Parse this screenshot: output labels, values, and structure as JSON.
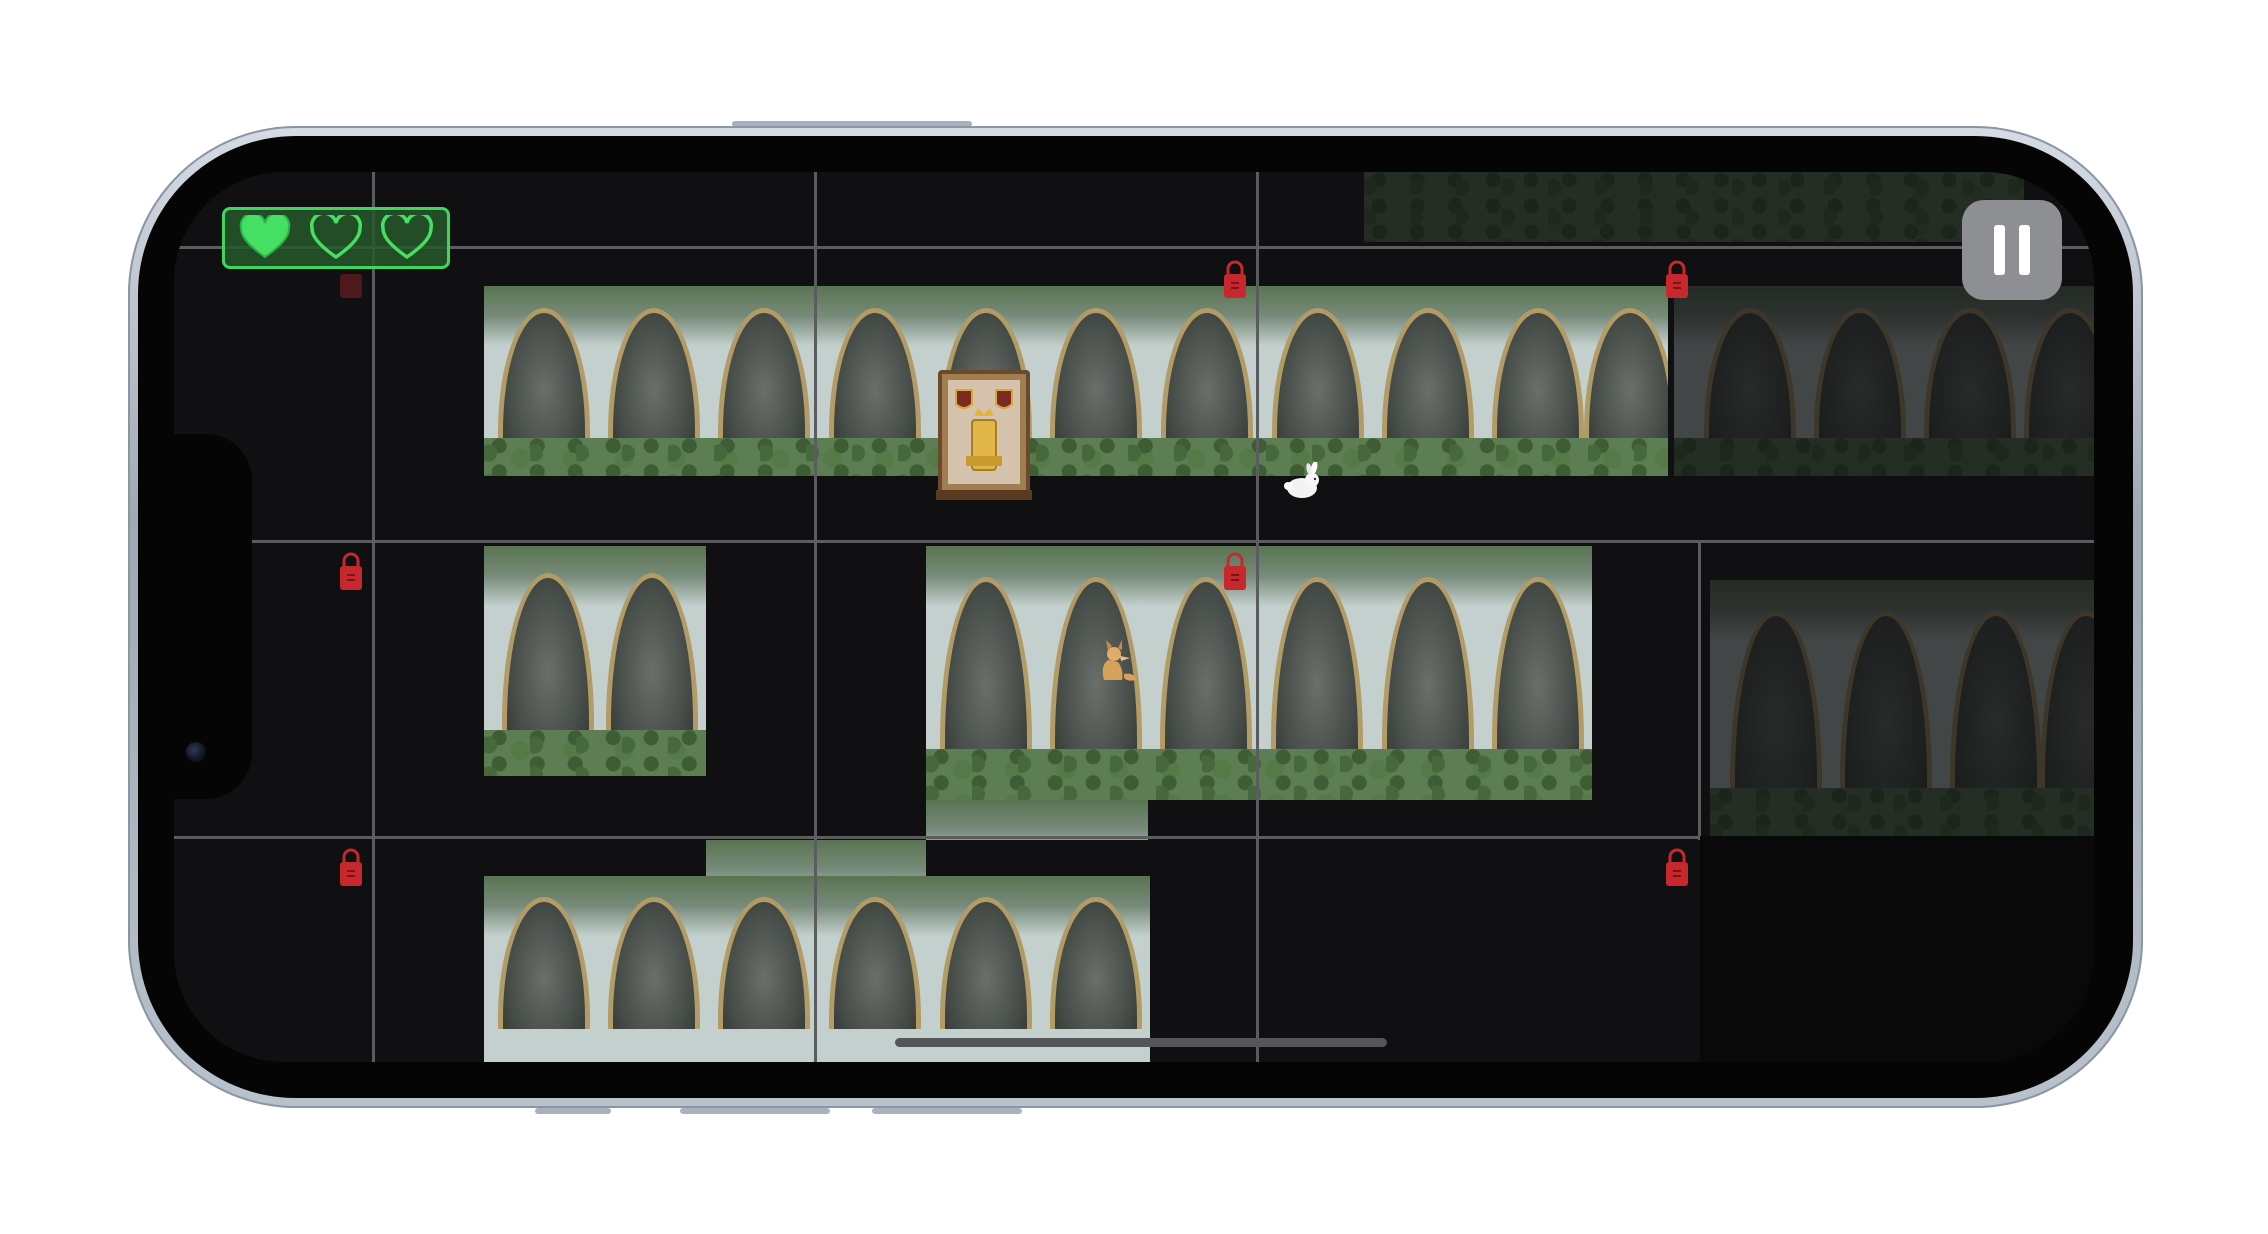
{
  "hud": {
    "hearts": [
      {
        "state": "filled",
        "icon": "heart-filled-icon"
      },
      {
        "state": "empty",
        "icon": "heart-outline-icon"
      },
      {
        "state": "empty",
        "icon": "heart-outline-icon"
      }
    ],
    "lives_remaining": 1,
    "lives_total": 3,
    "pause_icon": "pause-icon"
  },
  "map": {
    "locked_rooms_icon": "padlock-icon",
    "player": "white-rabbit",
    "enemy": "fox",
    "landmark": "throne"
  },
  "colors": {
    "hud_green": "#40d55c",
    "lock_red": "#c6282d",
    "background": "#101012",
    "grid": "#5b5c60"
  }
}
